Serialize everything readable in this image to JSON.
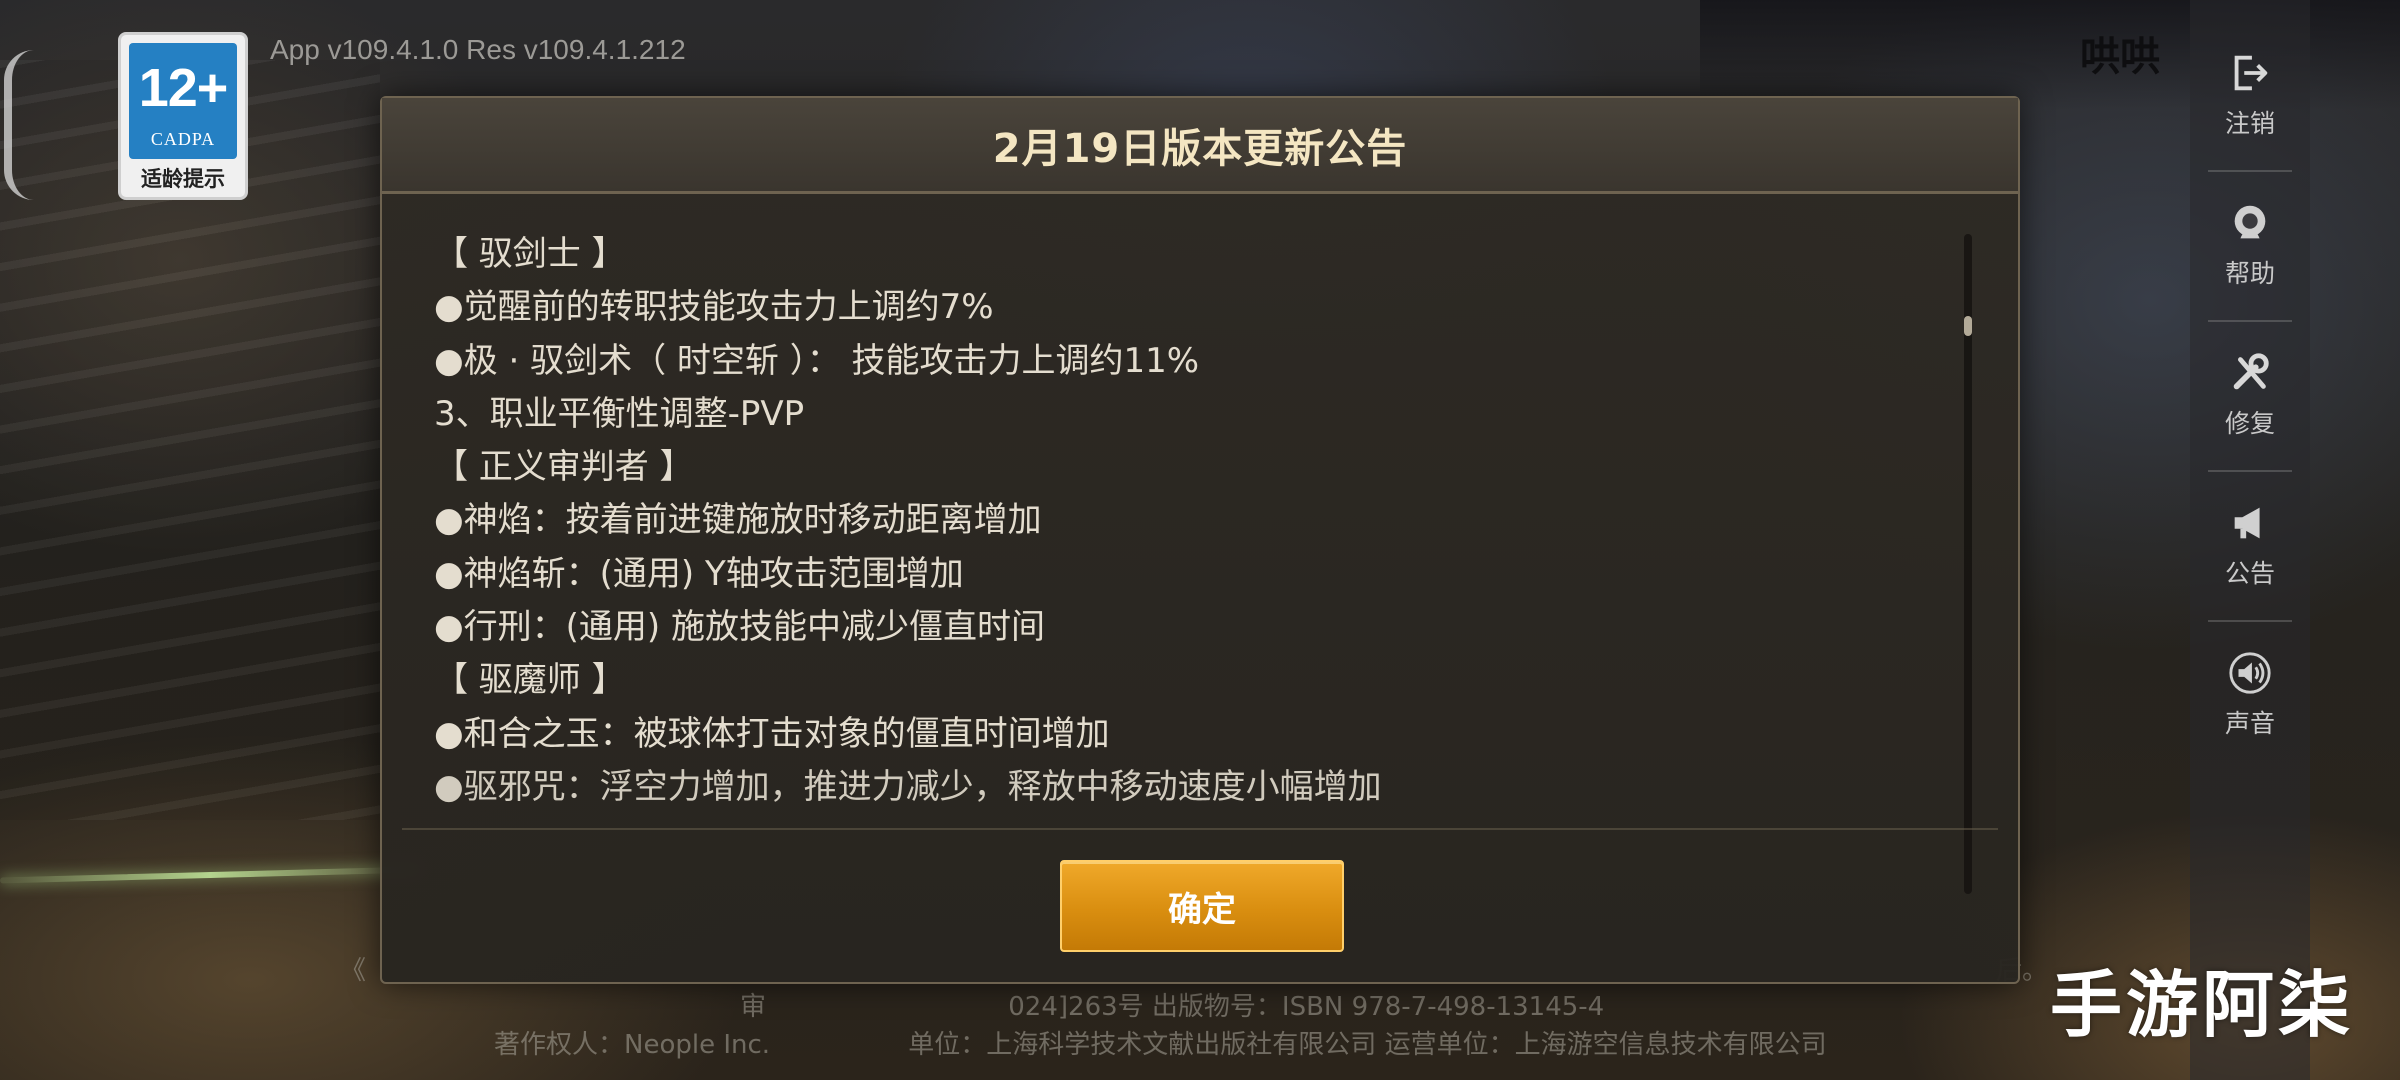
{
  "status": {
    "version": "App v109.4.1.0 Res v109.4.1.212",
    "age_rating": {
      "number": "12+",
      "org": "CADPA",
      "tip": "适龄提示"
    },
    "topright_text": "哄哄"
  },
  "side_menu": [
    {
      "label": "注销",
      "icon": "logout-icon"
    },
    {
      "label": "帮助",
      "icon": "help-icon"
    },
    {
      "label": "修复",
      "icon": "repair-icon"
    },
    {
      "label": "公告",
      "icon": "megaphone-icon"
    },
    {
      "label": "声音",
      "icon": "sound-icon"
    }
  ],
  "dialog": {
    "title": "2月19日版本更新公告",
    "lines": [
      "【 驭剑士 】",
      "●觉醒前的转职技能攻击力上调约7%",
      "●极 · 驭剑术（ 时空斩 ）： 技能攻击力上调约11%",
      "3、职业平衡性调整-PVP",
      "【 正义审判者 】",
      "●神焰：按着前进键施放时移动距离增加",
      "●神焰斩：(通用) Y轴攻击范围增加",
      "●行刑：(通用) 施放技能中减少僵直时间",
      "【 驱魔师 】",
      "●和合之玉：被球体打击对象的僵直时间增加",
      "●驱邪咒：浮空力增加，推进力减少，释放中移动速度小幅增加"
    ],
    "confirm_label": "确定"
  },
  "footer": {
    "line1": "《",
    "line2": "审 　　　　　　　　　024]263号 出版物号：ISBN 978-7-498-13145-4",
    "line3": "著作权人：Neople Inc.　　　　　 单位：上海科学技术文献出版社有限公司 运营单位：上海游空信息技术有限公司",
    "line1_end": "后。"
  },
  "watermark": "手游阿柒"
}
